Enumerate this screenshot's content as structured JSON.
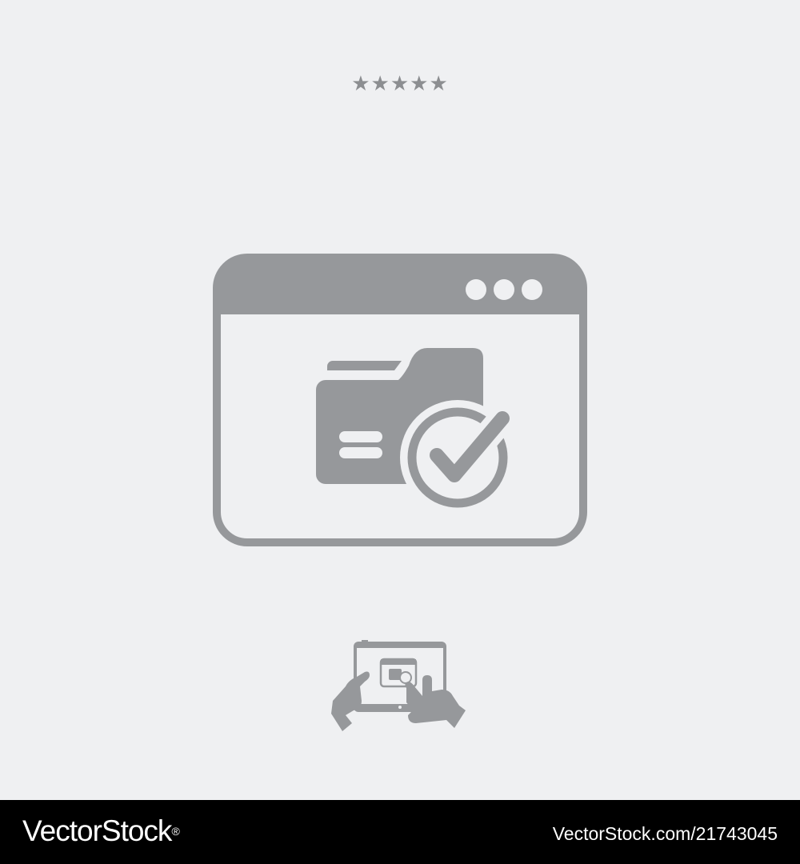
{
  "rating": {
    "stars": "★★★★★",
    "color": "#8c8e91"
  },
  "icons": {
    "main": "browser-window-folder-check-icon",
    "mini": "hands-tablet-touch-icon",
    "color": "#96989b",
    "background": "#eff0f2"
  },
  "watermark": {
    "brand": "VectorStock",
    "registered": "®",
    "url": "VectorStock.com/21743045",
    "text_color": "#ffffff",
    "bar_color": "#000000"
  }
}
